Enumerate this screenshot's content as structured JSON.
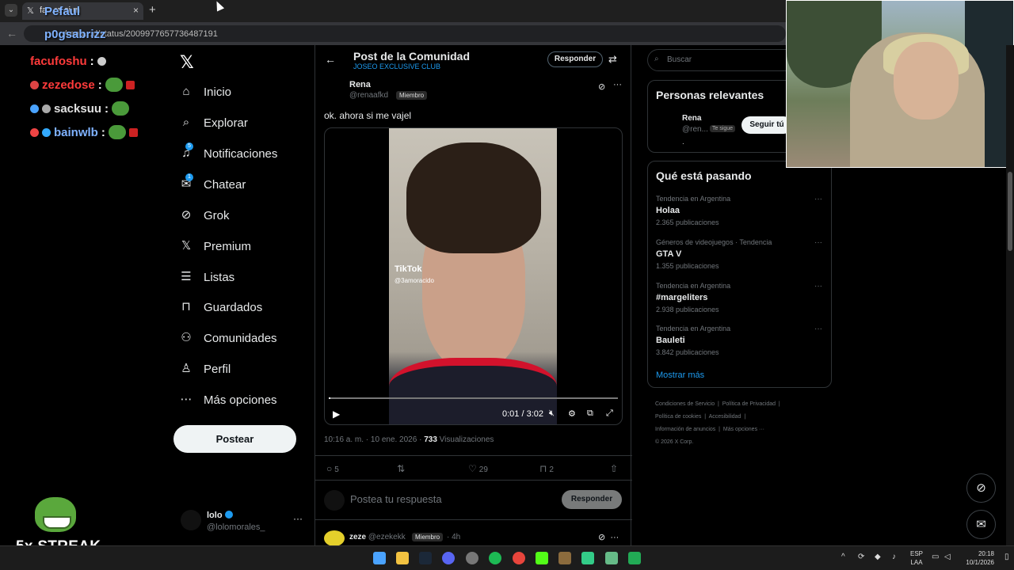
{
  "browser": {
    "tab_title": "(2) Rena en X: \"ok. ahora si me vajel\"",
    "tab_visible_text": "fa...ra si m",
    "url": "x.com/renaafkd/status/2009977657736487191",
    "url_display": "…/rena…d/status/2009977657736487191"
  },
  "overlay": {
    "names_top": [
      "Pefaul",
      "p0gsabrizz"
    ],
    "chat": [
      {
        "user": "facufoshu",
        "color": "#ff3b3b"
      },
      {
        "user": "zezedose",
        "color": "#ff3b3b"
      },
      {
        "user": "sacksuu",
        "color": "#e0e0e0"
      },
      {
        "user": "bainwlb",
        "color": "#7fb2ff"
      }
    ],
    "streak": "5x STREAK"
  },
  "nav": {
    "items": [
      {
        "label": "Inicio",
        "icon": "home-icon"
      },
      {
        "label": "Explorar",
        "icon": "search-icon"
      },
      {
        "label": "Notificaciones",
        "icon": "bell-icon",
        "badge": "5"
      },
      {
        "label": "Chatear",
        "icon": "mail-icon",
        "badge": "1"
      },
      {
        "label": "Grok",
        "icon": "grok-icon"
      },
      {
        "label": "Premium",
        "icon": "x-icon"
      },
      {
        "label": "Listas",
        "icon": "list-icon"
      },
      {
        "label": "Guardados",
        "icon": "bookmark-icon"
      },
      {
        "label": "Comunidades",
        "icon": "people-icon"
      },
      {
        "label": "Perfil",
        "icon": "person-icon"
      },
      {
        "label": "Más opciones",
        "icon": "more-circle-icon"
      }
    ],
    "post_button": "Postear",
    "account": {
      "name": "lolo",
      "handle": "@lolomorales_"
    }
  },
  "main": {
    "title": "Post de la Comunidad",
    "subtitle": "JOSEO EXCLUSIVE CLUB",
    "reply_pill": "Responder",
    "author": {
      "name": "Rena",
      "handle": "@renaafkd",
      "tag": "Miembro"
    },
    "text": "ok. ahora si me vajel",
    "video": {
      "watermark": "TikTok",
      "watermark_user": "@3amoracido",
      "time": "0:01 / 3:02",
      "progress": 0.006
    },
    "meta_time": "10:16 a. m. · 10 ene. 2026 · ",
    "views": "733",
    "views_label": " Visualizaciones",
    "actions": {
      "replies": "5",
      "likes": "29",
      "bookmarks": "2"
    },
    "reply_placeholder": "Postea tu respuesta",
    "reply_button": "Responder",
    "next_reply": {
      "name": "zeze",
      "handle": "@ezekekk",
      "tag": "Miembro",
      "time": "· 4h"
    }
  },
  "right": {
    "search_placeholder": "Buscar",
    "relevant_title": "Personas relevantes",
    "relevant": {
      "name": "Rena",
      "handle": "@ren...",
      "tag": "Te sigue",
      "bio": ".",
      "follow": "Seguir tú"
    },
    "trending_title": "Qué está pasando",
    "trends": [
      {
        "category": "Tendencia en Argentina",
        "name": "Holaa",
        "count": "2.365 publicaciones"
      },
      {
        "category": "Géneros de videojuegos · Tendencia",
        "name": "GTA V",
        "count": "1.355 publicaciones"
      },
      {
        "category": "Tendencia en Argentina",
        "name": "#margeliters",
        "count": "2.938 publicaciones"
      },
      {
        "category": "Tendencia en Argentina",
        "name": "Bauleti",
        "count": "3.842 publicaciones"
      }
    ],
    "show_more": "Mostrar más",
    "footer": [
      "Condiciones de Servicio",
      "Política de Privacidad",
      "Política de cookies",
      "Accesibilidad",
      "Información de anuncios",
      "Más opciones ···",
      "© 2026 X Corp."
    ]
  },
  "taskbar": {
    "lang_top": "ESP",
    "lang_bottom": "LAA",
    "time": "20:18",
    "date": "10/1/2026"
  }
}
